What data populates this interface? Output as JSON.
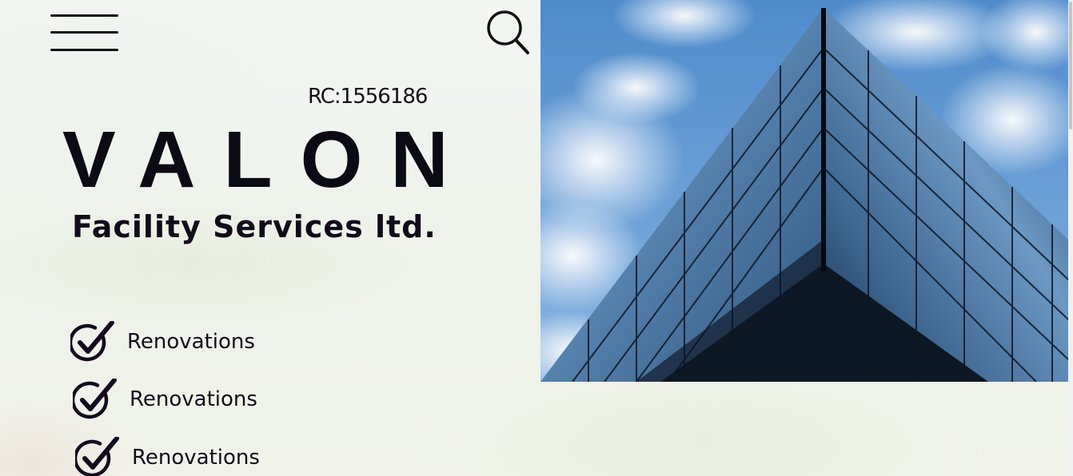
{
  "header": {
    "menu_icon": "hamburger-menu-icon",
    "search_icon": "search-icon"
  },
  "hero": {
    "registration": "RC:1556186",
    "brand_name": "VALON",
    "tagline": "Facility Services ltd.",
    "services": [
      {
        "label": "Renovations",
        "icon": "check-circle-icon"
      },
      {
        "label": "Renovations",
        "icon": "check-circle-icon"
      },
      {
        "label": "Renovations",
        "icon": "check-circle-icon"
      }
    ],
    "image": "glass-skyscraper-photo"
  },
  "colors": {
    "text": "#0c0a14",
    "background": "#f1f4ee",
    "sky": "#5b92cf",
    "glass_dark": "#0d1826"
  }
}
